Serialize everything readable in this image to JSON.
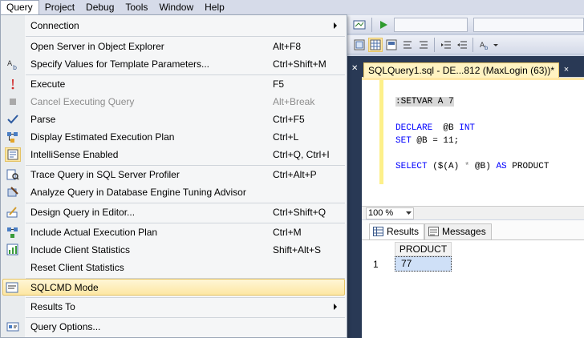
{
  "menubar": {
    "items": [
      "Query",
      "Project",
      "Debug",
      "Tools",
      "Window",
      "Help"
    ]
  },
  "query_menu": {
    "items": [
      {
        "label": "Connection",
        "shortcut": "",
        "submenu": true
      },
      {
        "label": "Open Server in Object Explorer",
        "shortcut": "Alt+F8"
      },
      {
        "label": "Specify Values for Template Parameters...",
        "shortcut": "Ctrl+Shift+M"
      },
      {
        "label": "Execute",
        "shortcut": "F5"
      },
      {
        "label": "Cancel Executing Query",
        "shortcut": "Alt+Break",
        "disabled": true
      },
      {
        "label": "Parse",
        "shortcut": "Ctrl+F5"
      },
      {
        "label": "Display Estimated Execution Plan",
        "shortcut": "Ctrl+L"
      },
      {
        "label": "IntelliSense Enabled",
        "shortcut": "Ctrl+Q, Ctrl+I"
      },
      {
        "label": "Trace Query in SQL Server Profiler",
        "shortcut": "Ctrl+Alt+P"
      },
      {
        "label": "Analyze Query in Database Engine Tuning Advisor",
        "shortcut": ""
      },
      {
        "label": "Design Query in Editor...",
        "shortcut": "Ctrl+Shift+Q"
      },
      {
        "label": "Include Actual Execution Plan",
        "shortcut": "Ctrl+M"
      },
      {
        "label": "Include Client Statistics",
        "shortcut": "Shift+Alt+S"
      },
      {
        "label": "Reset Client Statistics",
        "shortcut": ""
      },
      {
        "label": "SQLCMD Mode",
        "shortcut": "",
        "highlighted": true
      },
      {
        "label": "Results To",
        "shortcut": "",
        "submenu": true
      },
      {
        "label": "Query Options...",
        "shortcut": ""
      }
    ]
  },
  "document_tab": {
    "title": "SQLQuery1.sql - DE...812 (MaxLogin (63))*",
    "close": "×"
  },
  "editor": {
    "line1": ":SETVAR A 7",
    "declare_kw": "DECLARE",
    "declare_var": "  @B ",
    "declare_type": "INT",
    "set_kw": "SET",
    "set_rest": " @B = 11;",
    "select_kw": "SELECT",
    "select_rest_1": " ($(A) ",
    "select_op": "*",
    "select_rest_2": " @B) ",
    "as_kw": "AS",
    "select_alias": " PRODUCT"
  },
  "zoom": {
    "value": "100 %"
  },
  "results": {
    "tabs": [
      "Results",
      "Messages"
    ],
    "column": "PRODUCT",
    "row_number": "1",
    "value": "77"
  },
  "colors": {
    "menu_highlight": "#fde7a3",
    "doc_tab": "#fff3c2",
    "dark_chrome": "#293955",
    "keyword": "#0000ff"
  }
}
